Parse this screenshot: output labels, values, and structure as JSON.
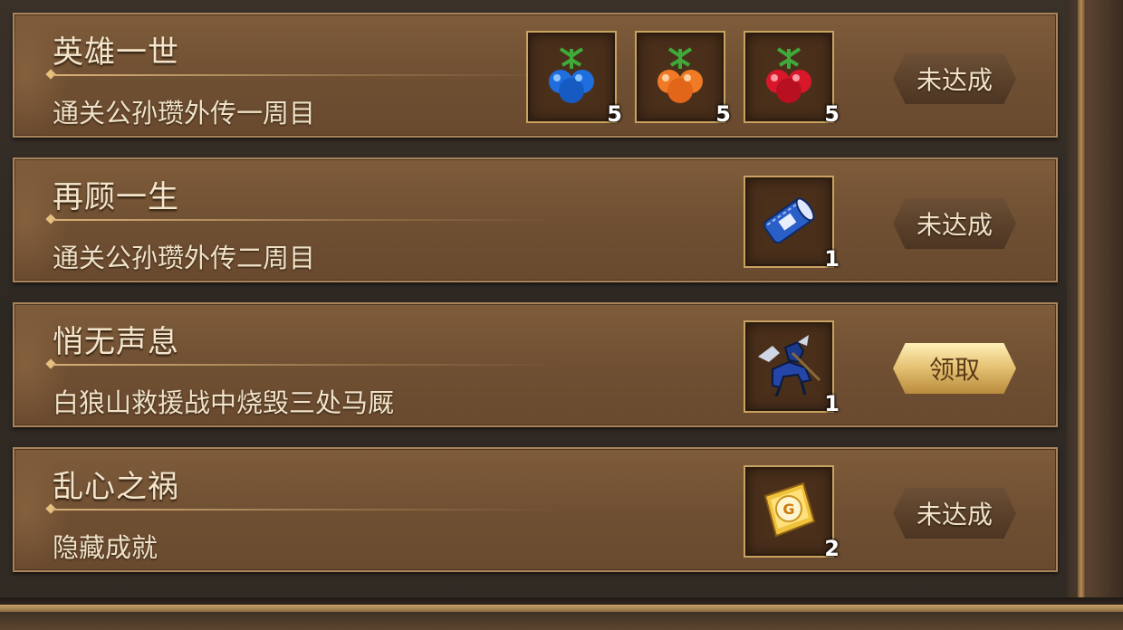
{
  "achievements": [
    {
      "title": "英雄一世",
      "description": "通关公孙瓒外传一周目",
      "rewards": [
        {
          "icon": "blue-berry-icon",
          "color": "#1f6ee0",
          "quantity": "5"
        },
        {
          "icon": "orange-berry-icon",
          "color": "#f07a26",
          "quantity": "5"
        },
        {
          "icon": "red-berry-icon",
          "color": "#d8182a",
          "quantity": "5"
        }
      ],
      "button": {
        "label": "未达成",
        "state": "not-achieved"
      }
    },
    {
      "title": "再顾一生",
      "description": "通关公孙瓒外传二周目",
      "rewards": [
        {
          "icon": "scroll-icon",
          "color": "#2b5fc8",
          "quantity": "1"
        }
      ],
      "button": {
        "label": "未达成",
        "state": "not-achieved"
      }
    },
    {
      "title": "悄无声息",
      "description": "白狼山救援战中烧毁三处马厩",
      "rewards": [
        {
          "icon": "cavalry-unit-icon",
          "color": "#2346a8",
          "quantity": "1"
        }
      ],
      "button": {
        "label": "领取",
        "state": "claimable"
      }
    },
    {
      "title": "乱心之祸",
      "description": "隐藏成就",
      "rewards": [
        {
          "icon": "gold-ingot-icon",
          "color": "#f0c23c",
          "quantity": "2"
        }
      ],
      "button": {
        "label": "未达成",
        "state": "not-achieved"
      }
    }
  ]
}
